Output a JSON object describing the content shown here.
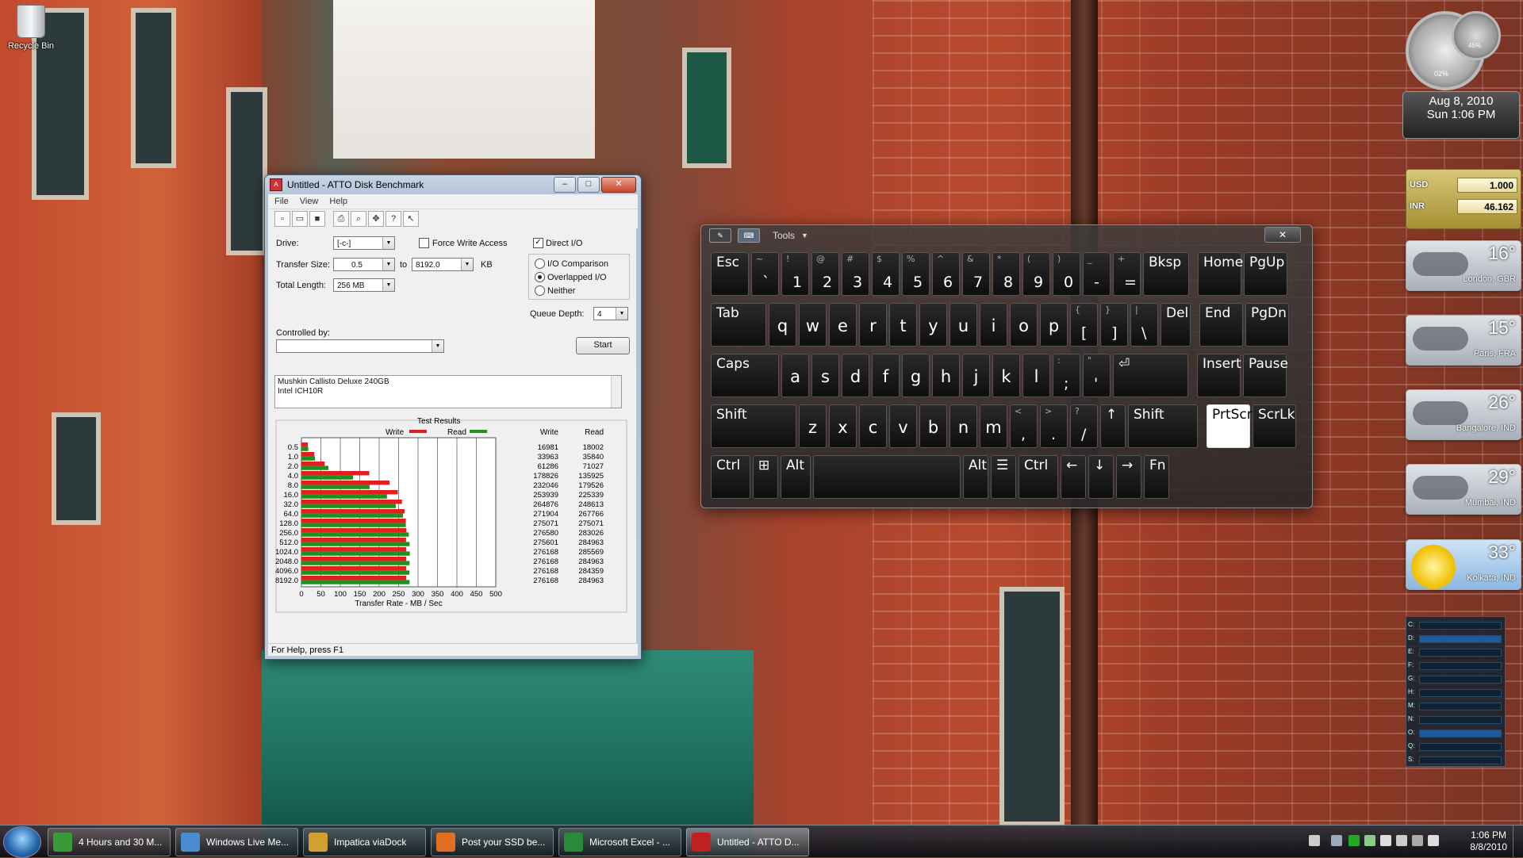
{
  "desktop": {
    "recycle_bin_label": "Recycle Bin"
  },
  "atto": {
    "title": "Untitled - ATTO Disk Benchmark",
    "menu": [
      "File",
      "View",
      "Help"
    ],
    "drive_label": "Drive:",
    "drive_value": "[-c-]",
    "transfer_size_label": "Transfer Size:",
    "transfer_from": "0.5",
    "transfer_to_label": "to",
    "transfer_to": "8192.0",
    "transfer_unit": "KB",
    "total_length_label": "Total Length:",
    "total_length_value": "256 MB",
    "force_write_label": "Force Write Access",
    "direct_io_label": "Direct I/O",
    "io_comparison_label": "I/O Comparison",
    "overlapped_io_label": "Overlapped I/O",
    "neither_label": "Neither",
    "queue_depth_label": "Queue Depth:",
    "queue_depth_value": "4",
    "controlled_by_label": "Controlled by:",
    "start_label": "Start",
    "notes_line1": "Mushkin Callisto Deluxe 240GB",
    "notes_line2": "Intel ICH10R",
    "status": "For Help, press F1"
  },
  "chart_data": {
    "type": "bar",
    "title": "Test Results",
    "xlabel": "Transfer Rate - MB / Sec",
    "xlim": [
      0,
      500
    ],
    "xticks": [
      0,
      50,
      100,
      150,
      200,
      250,
      300,
      350,
      400,
      450,
      500
    ],
    "categories": [
      "0.5",
      "1.0",
      "2.0",
      "4.0",
      "8.0",
      "16.0",
      "32.0",
      "64.0",
      "128.0",
      "256.0",
      "512.0",
      "1024.0",
      "2048.0",
      "4096.0",
      "8192.0"
    ],
    "legend": [
      "Write",
      "Read"
    ],
    "column_headers": [
      "Write",
      "Read"
    ],
    "series": [
      {
        "name": "Write",
        "color": "#e02020",
        "values": [
          16981,
          33963,
          61286,
          178826,
          232046,
          253939,
          264876,
          271904,
          275071,
          276580,
          275601,
          276168,
          276168,
          276168,
          276168
        ]
      },
      {
        "name": "Read",
        "color": "#209020",
        "values": [
          18002,
          35840,
          71027,
          135925,
          179526,
          225339,
          248613,
          267766,
          275071,
          283026,
          284963,
          285569,
          284963,
          284359,
          284963
        ]
      }
    ]
  },
  "osk": {
    "tools_label": "Tools",
    "close": "✕"
  },
  "gadgets": {
    "cpu_percent": "02%",
    "mem_percent": "45%",
    "date": "Aug 8, 2010",
    "day_time": "Sun 1:06 PM",
    "currency": [
      {
        "code": "USD",
        "value": "1.000"
      },
      {
        "code": "INR",
        "value": "46.162"
      }
    ],
    "weather": [
      {
        "temp": "16°",
        "city": "London, GBR"
      },
      {
        "temp": "15°",
        "city": "Paris, FRA"
      },
      {
        "temp": "26°",
        "city": "Bangalore, IND"
      },
      {
        "temp": "29°",
        "city": "Mumbai, IND"
      },
      {
        "temp": "33°",
        "city": "Kolkata, IND"
      }
    ],
    "drives": [
      "C:",
      "D:",
      "E:",
      "F:",
      "G:",
      "H:",
      "M:",
      "N:",
      "O:",
      "Q:",
      "S:"
    ]
  },
  "taskbar": {
    "tasks": [
      {
        "label": "4 Hours and 30 M...",
        "icon": "progress-icon",
        "color": "#3a9a3a"
      },
      {
        "label": "Windows Live Me...",
        "icon": "messenger-icon",
        "color": "#4a8ad0"
      },
      {
        "label": "Impatica viaDock",
        "icon": "dock-icon",
        "color": "#d0a030"
      },
      {
        "label": "Post your SSD be...",
        "icon": "firefox-icon",
        "color": "#e07020"
      },
      {
        "label": "Microsoft Excel - ...",
        "icon": "excel-icon",
        "color": "#2a8a3a"
      },
      {
        "label": "Untitled - ATTO D...",
        "icon": "atto-icon",
        "color": "#c02020"
      }
    ],
    "time": "1:06 PM",
    "date": "8/8/2010"
  }
}
